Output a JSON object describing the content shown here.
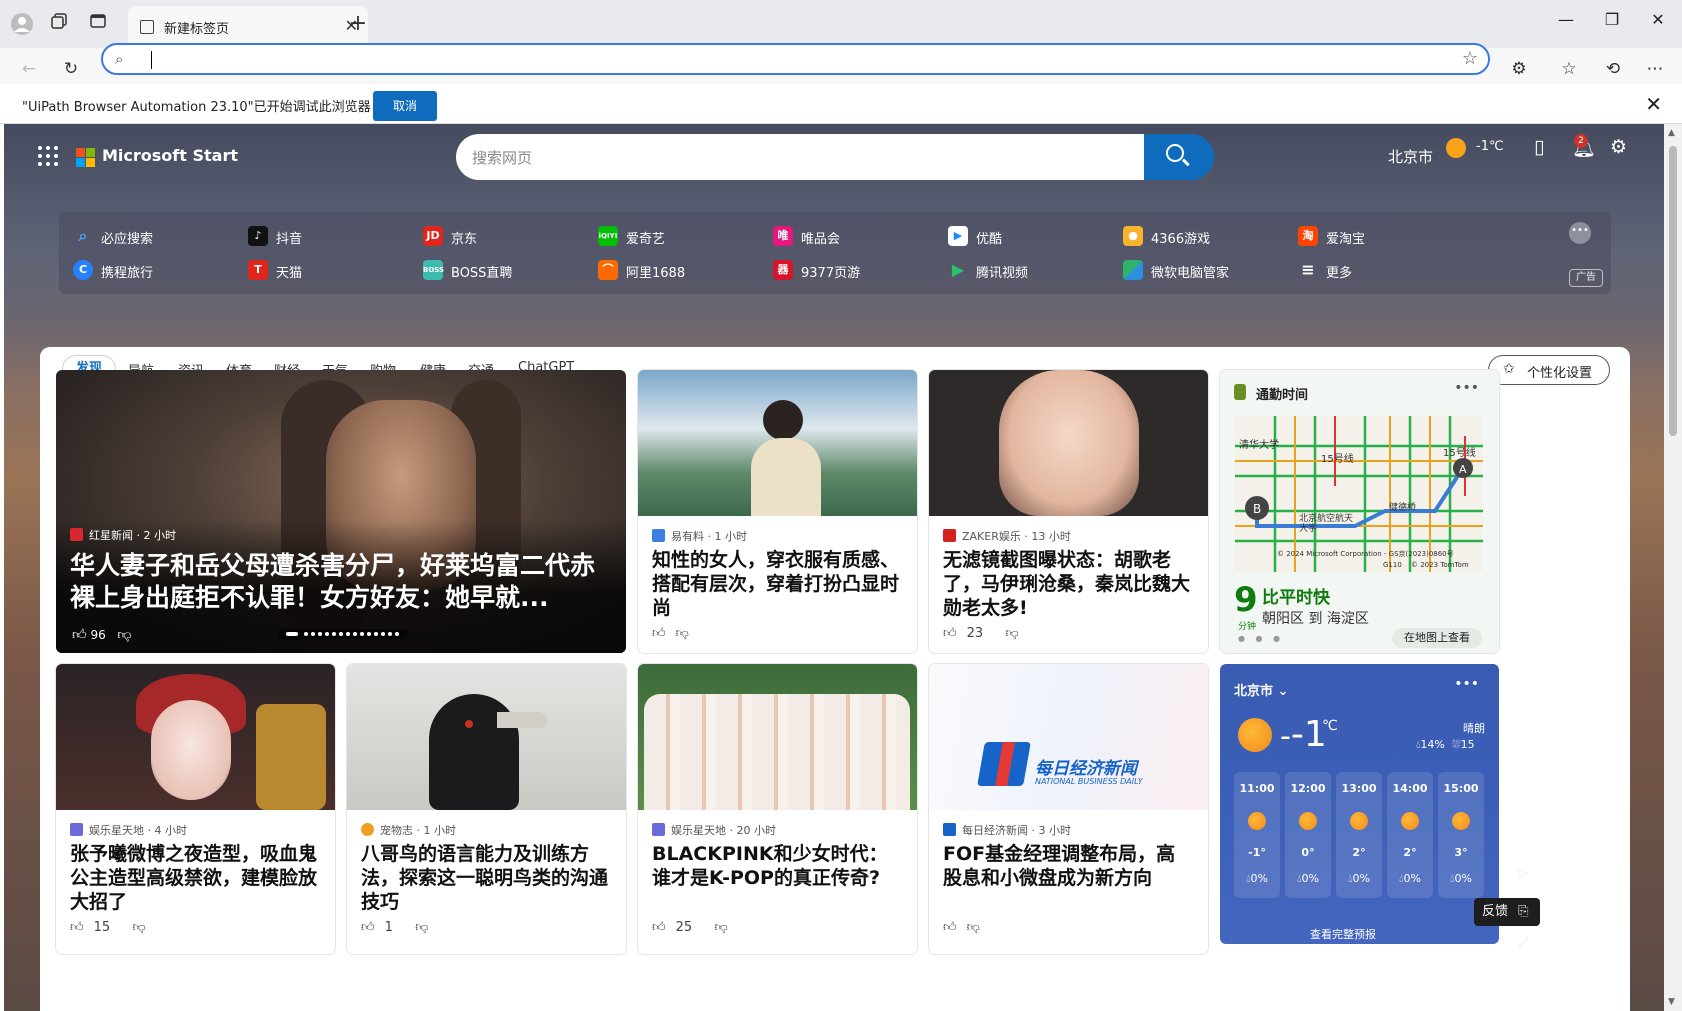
{
  "browser": {
    "tab_title": "新建标签页",
    "address_value": "",
    "infobar_message": "\"UiPath Browser Automation 23.10\"已开始调试此浏览器",
    "infobar_cancel": "取消"
  },
  "header": {
    "brand": "Microsoft Start",
    "search_placeholder": "搜索网页",
    "city": "北京市",
    "temperature": "-1℃",
    "notifications_count": "2"
  },
  "quick_links": {
    "row1": [
      "必应搜索",
      "抖音",
      "京东",
      "爱奇艺",
      "唯品会",
      "优酷",
      "4366游戏",
      "爱淘宝"
    ],
    "row2": [
      "携程旅行",
      "天猫",
      "BOSS直聘",
      "阿里1688",
      "9377页游",
      "腾讯视频",
      "微软电脑管家",
      "更多"
    ],
    "ad_label": "广告"
  },
  "tabs": [
    "发现",
    "导航",
    "资讯",
    "体育",
    "财经",
    "天气",
    "购物",
    "健康",
    "交通",
    "ChatGPT"
  ],
  "personalize_label": "个性化设置",
  "hero": {
    "source": "红星新闻 · 2 小时",
    "title": "华人妻子和岳父母遭杀害分尸，好莱坞富二代赤裸上身出庭拒不认罪！女方好友：她早就...",
    "likes": "96"
  },
  "cards": [
    {
      "source": "易有料 · 1 小时",
      "title": "知性的女人，穿衣服有质感、搭配有层次，穿着打扮凸显时尚",
      "likes": ""
    },
    {
      "source": "ZAKER娱乐 · 13 小时",
      "title": "无滤镜截图曝状态：胡歌老了，马伊琍沧桑，秦岚比魏大勋老太多!",
      "likes": "23"
    },
    {
      "source": "娱乐星天地 · 4 小时",
      "title": "张予曦微博之夜造型，吸血鬼公主造型高级禁欲，建模脸放大招了",
      "likes": "15"
    },
    {
      "source": "宠物志 · 1 小时",
      "title": "八哥鸟的语言能力及训练方法，探索这一聪明鸟类的沟通技巧",
      "likes": "1"
    },
    {
      "source": "娱乐星天地 · 20 小时",
      "title": "BLACKPINK和少女时代：谁才是K-POP的真正传奇?",
      "likes": "25"
    },
    {
      "source": "每日经济新闻 · 3 小时",
      "title": "FOF基金经理调整布局，高股息和小微盘成为新方向",
      "likes": ""
    }
  ],
  "news_logo": {
    "cn": "每日经济新闻",
    "en": "NATIONAL BUSINESS DAILY"
  },
  "commute": {
    "title": "通勤时间",
    "minutes": "9",
    "minutes_unit": "分钟",
    "route_title": "比平时快",
    "route": "朝阳区 到 海淀区",
    "view_map": "在地图上查看",
    "map_labels": [
      "清华大学",
      "15号线",
      "15号线",
      "北京航空航天大学",
      "健德桥",
      "© 2024 Microsoft Corporation - GS京(2023)0860号",
      "© 2023 TomTom",
      "G110"
    ]
  },
  "weather": {
    "city": "北京市",
    "temp": "-1",
    "unit": "℃",
    "condition": "晴朗",
    "humidity": "14%",
    "wind": "15",
    "forecast_link": "查看完整预报",
    "hours": [
      {
        "time": "11:00",
        "temp": "-1°",
        "precip": "0%"
      },
      {
        "time": "12:00",
        "temp": "0°",
        "precip": "0%"
      },
      {
        "time": "13:00",
        "temp": "2°",
        "precip": "0%"
      },
      {
        "time": "14:00",
        "temp": "2°",
        "precip": "0%"
      },
      {
        "time": "15:00",
        "temp": "3°",
        "precip": "0%"
      }
    ]
  },
  "feedback_label": "反馈",
  "colors": {
    "accent": "#0f6cbd",
    "commute_green": "#107c10",
    "weather_bg": "#3c5fb7"
  }
}
